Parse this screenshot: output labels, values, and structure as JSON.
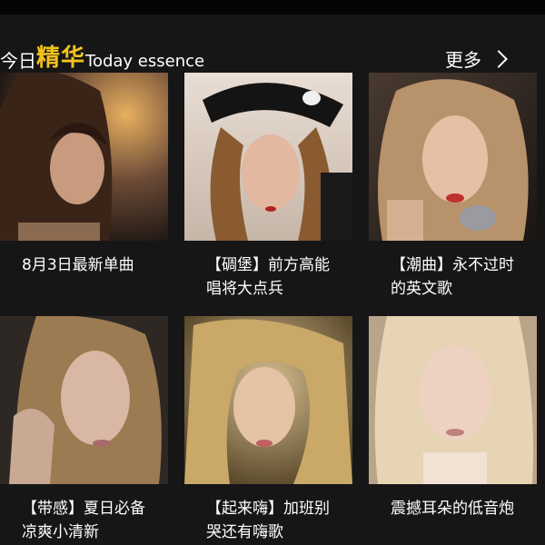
{
  "header": {
    "title_prefix": "今日",
    "title_accent": "精华",
    "title_en": "Today essence",
    "more_label": "更多"
  },
  "colors": {
    "accent": "#f2c21d",
    "background": "#161617",
    "text": "#ffffff"
  },
  "items": [
    {
      "caption": "8月3日最新单曲",
      "image": "portrait-photo"
    },
    {
      "caption": "【碉堡】前方高能唱将大点兵",
      "image": "portrait-photo"
    },
    {
      "caption": "【潮曲】永不过时的英文歌",
      "image": "portrait-photo"
    },
    {
      "caption": "【带感】夏日必备凉爽小清新",
      "image": "portrait-photo"
    },
    {
      "caption": "【起来嗨】加班别哭还有嗨歌",
      "image": "portrait-photo"
    },
    {
      "caption": "震撼耳朵的低音炮",
      "image": "portrait-photo"
    }
  ]
}
